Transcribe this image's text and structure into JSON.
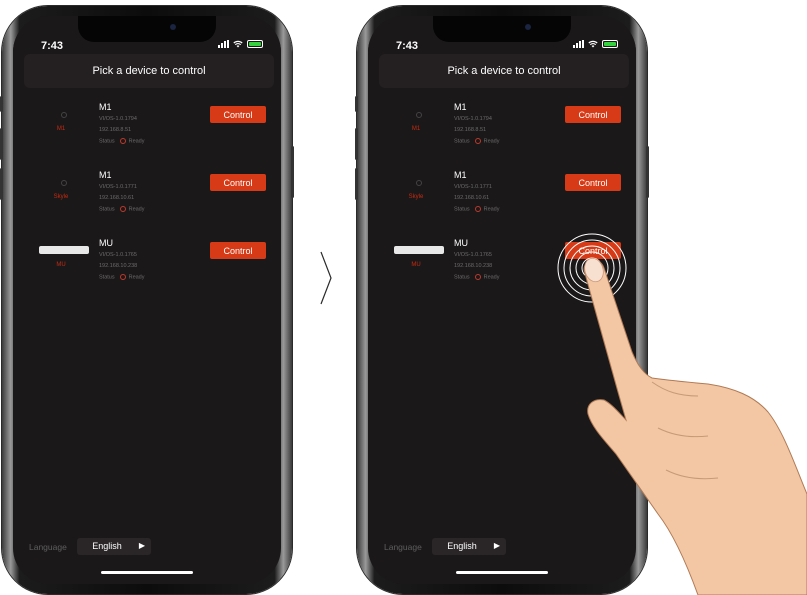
{
  "left_phone": {
    "status": {
      "time": "7:43"
    },
    "header": {
      "title": "Pick a device to control"
    },
    "devices": [
      {
        "name": "M1",
        "firmware": "VI/OS-1.0.1794",
        "ip": "192.168.8.51",
        "status_label": "Status",
        "status_value": "Ready",
        "thumb_label": "M1",
        "control_label": "Control",
        "thumb_icon": "small-device-icon"
      },
      {
        "name": "M1",
        "firmware": "VI/OS-1.0.1771",
        "ip": "192.168.10.61",
        "status_label": "Status",
        "status_value": "Ready",
        "thumb_label": "Skyle",
        "control_label": "Control",
        "thumb_icon": "small-device-icon"
      },
      {
        "name": "MU",
        "firmware": "VI/OS-1.0.1765",
        "ip": "192.168.10.238",
        "status_label": "Status",
        "status_value": "Ready",
        "thumb_label": "MU",
        "control_label": "Control",
        "thumb_icon": "soundbar-device-icon"
      }
    ],
    "footer": {
      "language_label": "Language",
      "language_value": "English"
    }
  },
  "right_phone": {
    "status": {
      "time": "7:43"
    },
    "header": {
      "title": "Pick a device to control"
    },
    "devices": [
      {
        "name": "M1",
        "firmware": "VI/OS-1.0.1794",
        "ip": "192.168.8.51",
        "status_label": "Status",
        "status_value": "Ready",
        "thumb_label": "M1",
        "control_label": "Control",
        "thumb_icon": "small-device-icon"
      },
      {
        "name": "M1",
        "firmware": "VI/OS-1.0.1771",
        "ip": "192.168.10.61",
        "status_label": "Status",
        "status_value": "Ready",
        "thumb_label": "Skyle",
        "control_label": "Control",
        "thumb_icon": "small-device-icon"
      },
      {
        "name": "MU",
        "firmware": "VI/OS-1.0.1765",
        "ip": "192.168.10.238",
        "status_label": "Status",
        "status_value": "Ready",
        "thumb_label": "MU",
        "control_label": "Control",
        "thumb_icon": "soundbar-device-icon"
      }
    ],
    "footer": {
      "language_label": "Language",
      "language_value": "English"
    }
  },
  "colors": {
    "accent": "#d63a16",
    "screen_bg": "#1b1819",
    "status_ready": "#c0392b",
    "battery": "#35d13f"
  },
  "icons": {
    "transition": "chevron-right-icon",
    "gesture": "tapping-hand-icon",
    "battery": "battery-icon",
    "wifi": "wifi-icon",
    "cellular": "cellular-signal-icon",
    "language_arrow": "play-arrow-icon"
  }
}
